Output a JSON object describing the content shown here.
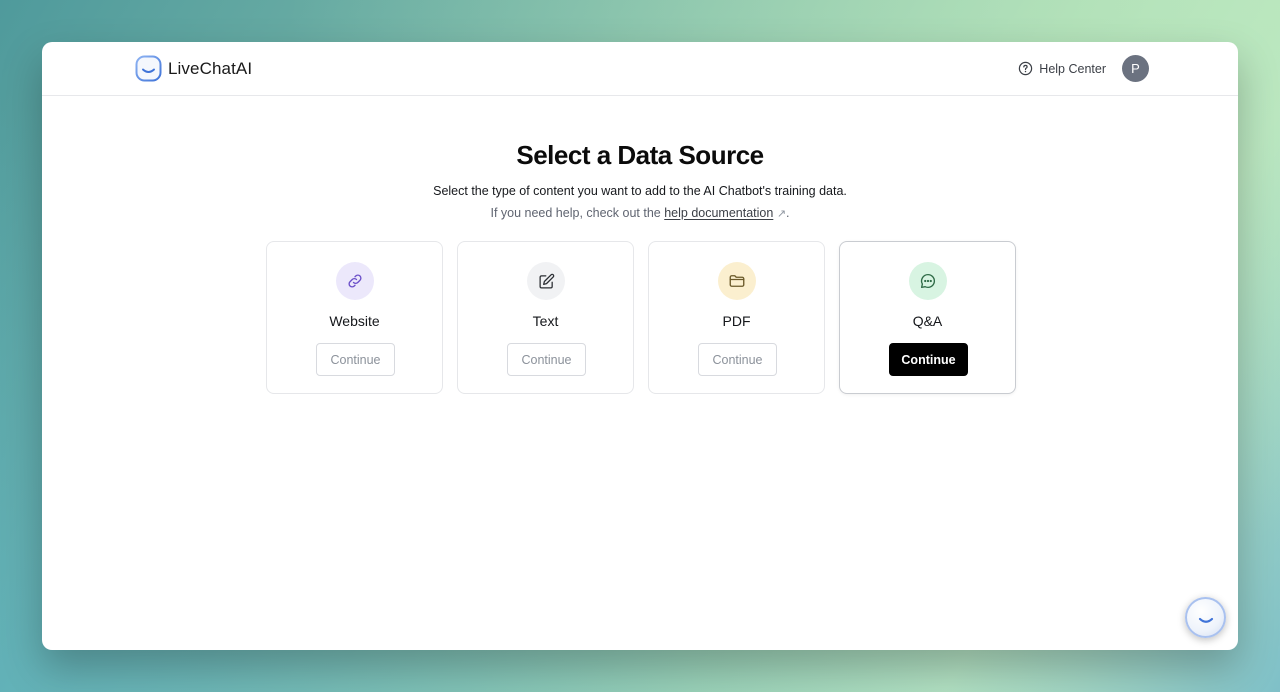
{
  "app": {
    "logo_text": "LiveChatAI",
    "help_center": "Help Center",
    "avatar_initial": "P"
  },
  "main": {
    "title": "Select a Data Source",
    "subtitle": "Select the type of content you want to add to the AI Chatbot's training data.",
    "help_prefix": "If you need help, check out the ",
    "help_link": "help documentation",
    "help_suffix": ".",
    "external_glyph": "↗"
  },
  "cards": [
    {
      "label": "Website",
      "icon": "link-icon",
      "button": "Continue",
      "icon_bg": "#ece8fb",
      "icon_color": "#6b4fc9",
      "selected": false
    },
    {
      "label": "Text",
      "icon": "edit-icon",
      "button": "Continue",
      "icon_bg": "#f1f2f4",
      "icon_color": "#2b2e33",
      "selected": false
    },
    {
      "label": "PDF",
      "icon": "folder-icon",
      "button": "Continue",
      "icon_bg": "#fbefcf",
      "icon_color": "#6b5a2a",
      "selected": false
    },
    {
      "label": "Q&A",
      "icon": "chat-bubble-icon",
      "button": "Continue",
      "icon_bg": "#d8f4e2",
      "icon_color": "#2f6b47",
      "selected": true
    }
  ],
  "colors": {
    "primary_button": "#000000",
    "brand": "#5b8ee6"
  }
}
